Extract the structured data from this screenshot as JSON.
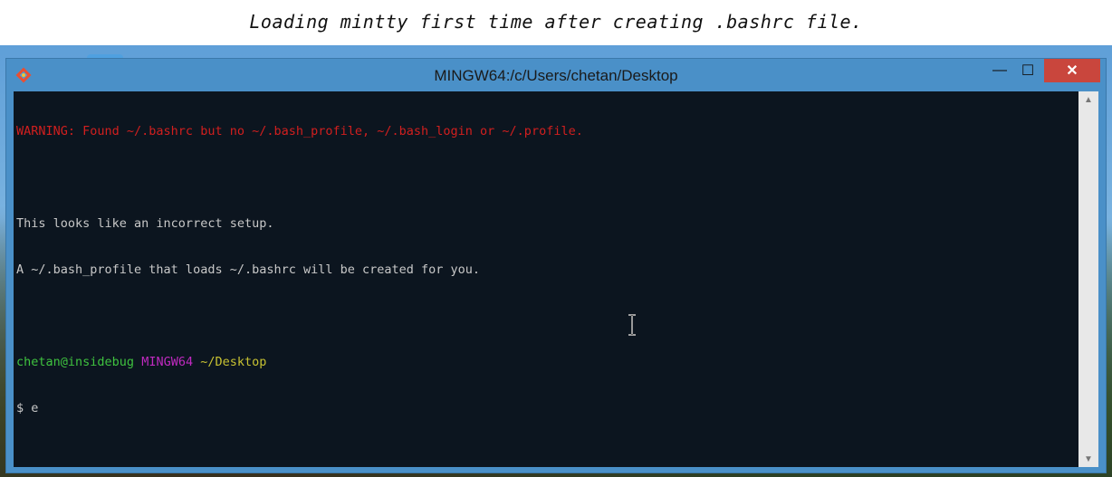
{
  "caption": "Loading mintty first time after creating .bashrc file.",
  "window": {
    "title": "MINGW64:/c/Users/chetan/Desktop",
    "minimize_symbol": "—",
    "maximize_symbol": "☐",
    "close_symbol": "✕"
  },
  "terminal": {
    "warning": "WARNING: Found ~/.bashrc but no ~/.bash_profile, ~/.bash_login or ~/.profile.",
    "line1": "This looks like an incorrect setup.",
    "line2": "A ~/.bash_profile that loads ~/.bashrc will be created for you.",
    "prompt_user": "chetan@insidebug",
    "prompt_system": "MINGW64",
    "prompt_path": "~/Desktop",
    "command": "$ e"
  },
  "colors": {
    "warning": "#d21f1f",
    "user": "#3fc23f",
    "system": "#c02ac0",
    "path": "#c8c232",
    "close_button": "#c9463d"
  },
  "icons": [
    "git-diamond-icon",
    "minimize-icon",
    "maximize-icon",
    "close-icon",
    "scroll-up-icon",
    "scroll-down-icon",
    "text-cursor-icon"
  ]
}
